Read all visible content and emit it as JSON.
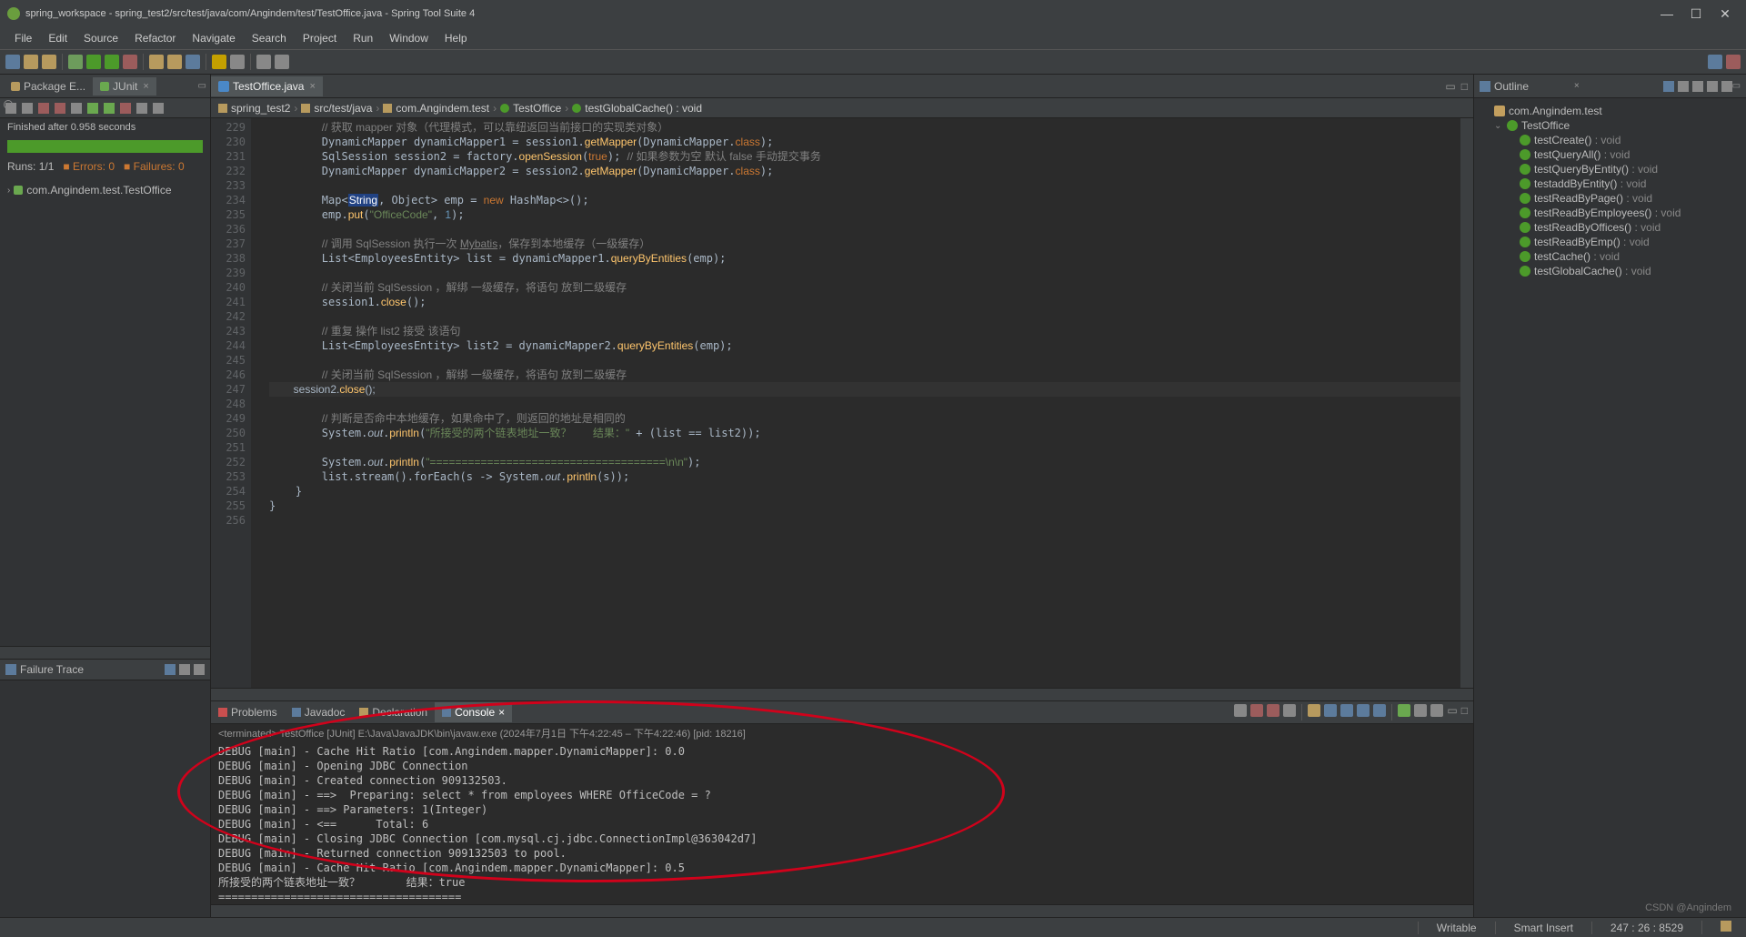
{
  "title": "spring_workspace - spring_test2/src/test/java/com/Angindem/test/TestOffice.java - Spring Tool Suite 4",
  "menus": [
    "File",
    "Edit",
    "Source",
    "Refactor",
    "Navigate",
    "Search",
    "Project",
    "Run",
    "Window",
    "Help"
  ],
  "left": {
    "tab1": "Package E...",
    "tab2": "JUnit",
    "finished": "Finished after 0.958 seconds",
    "runs_label": "Runs:",
    "runs_val": "1/1",
    "errors_label": "Errors:",
    "errors_val": "0",
    "failures_label": "Failures:",
    "failures_val": "0",
    "tree_item": "com.Angindem.test.TestOffice",
    "failure_trace": "Failure Trace"
  },
  "editor": {
    "tab": "TestOffice.java",
    "bc1": "spring_test2",
    "bc2": "src/test/java",
    "bc3": "com.Angindem.test",
    "bc4": "TestOffice",
    "bc5": "testGlobalCache() : void",
    "lines_start": 229,
    "lines_end": 256
  },
  "bottom": {
    "t_problems": "Problems",
    "t_javadoc": "Javadoc",
    "t_decl": "Declaration",
    "t_console": "Console",
    "header": "<terminated> TestOffice [JUnit] E:\\Java\\JavaJDK\\bin\\javaw.exe (2024年7月1日 下午4:22:45 – 下午4:22:46) [pid: 18216]",
    "console_lines": [
      "DEBUG [main] - Cache Hit Ratio [com.Angindem.mapper.DynamicMapper]: 0.0",
      "DEBUG [main] - Opening JDBC Connection",
      "DEBUG [main] - Created connection 909132503.",
      "DEBUG [main] - ==>  Preparing: select * from employees WHERE OfficeCode = ?",
      "DEBUG [main] - ==> Parameters: 1(Integer)",
      "DEBUG [main] - <==      Total: 6",
      "DEBUG [main] - Closing JDBC Connection [com.mysql.cj.jdbc.ConnectionImpl@363042d7]",
      "DEBUG [main] - Returned connection 909132503 to pool.",
      "DEBUG [main] - Cache Hit Ratio [com.Angindem.mapper.DynamicMapper]: 0.5",
      "所接受的两个链表地址一致？       结果：true",
      "====================================="
    ]
  },
  "outline": {
    "title": "Outline",
    "pkg": "com.Angindem.test",
    "cls": "TestOffice",
    "methods": [
      {
        "n": "testCreate()",
        "r": ": void"
      },
      {
        "n": "testQueryAll()",
        "r": ": void"
      },
      {
        "n": "testQueryByEntity()",
        "r": ": void"
      },
      {
        "n": "testaddByEntity()",
        "r": ": void"
      },
      {
        "n": "testReadByPage()",
        "r": ": void"
      },
      {
        "n": "testReadByEmployees()",
        "r": ": void"
      },
      {
        "n": "testReadByOffices()",
        "r": ": void"
      },
      {
        "n": "testReadByEmp()",
        "r": ": void"
      },
      {
        "n": "testCache()",
        "r": ": void"
      },
      {
        "n": "testGlobalCache()",
        "r": ": void"
      }
    ]
  },
  "status": {
    "writable": "Writable",
    "insert": "Smart Insert",
    "pos": "247 : 26 : 8529"
  },
  "watermark": "CSDN @Angindem"
}
